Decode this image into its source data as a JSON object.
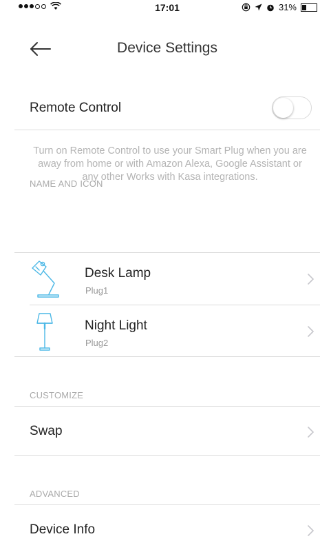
{
  "status_bar": {
    "time": "17:01",
    "battery": "31%",
    "battery_level": 0.31
  },
  "nav": {
    "title": "Device Settings"
  },
  "remote_control": {
    "label": "Remote Control",
    "enabled": false,
    "description": "Turn on Remote Control to use your Smart Plug when you are away from home or with Amazon Alexa, Google Assistant or any other Works with Kasa integrations."
  },
  "sections": {
    "name_and_icon": {
      "header": "NAME AND ICON",
      "devices": [
        {
          "name": "Desk Lamp",
          "sub": "Plug1",
          "icon": "desk-lamp-icon"
        },
        {
          "name": "Night Light",
          "sub": "Plug2",
          "icon": "floor-lamp-icon"
        }
      ]
    },
    "customize": {
      "header": "CUSTOMIZE",
      "items": [
        {
          "label": "Swap"
        }
      ]
    },
    "advanced": {
      "header": "ADVANCED",
      "items": [
        {
          "label": "Device Info"
        }
      ]
    }
  },
  "colors": {
    "accent": "#4cb8e6",
    "divider": "#dcdcdc",
    "muted_text": "#b4b4b4"
  }
}
